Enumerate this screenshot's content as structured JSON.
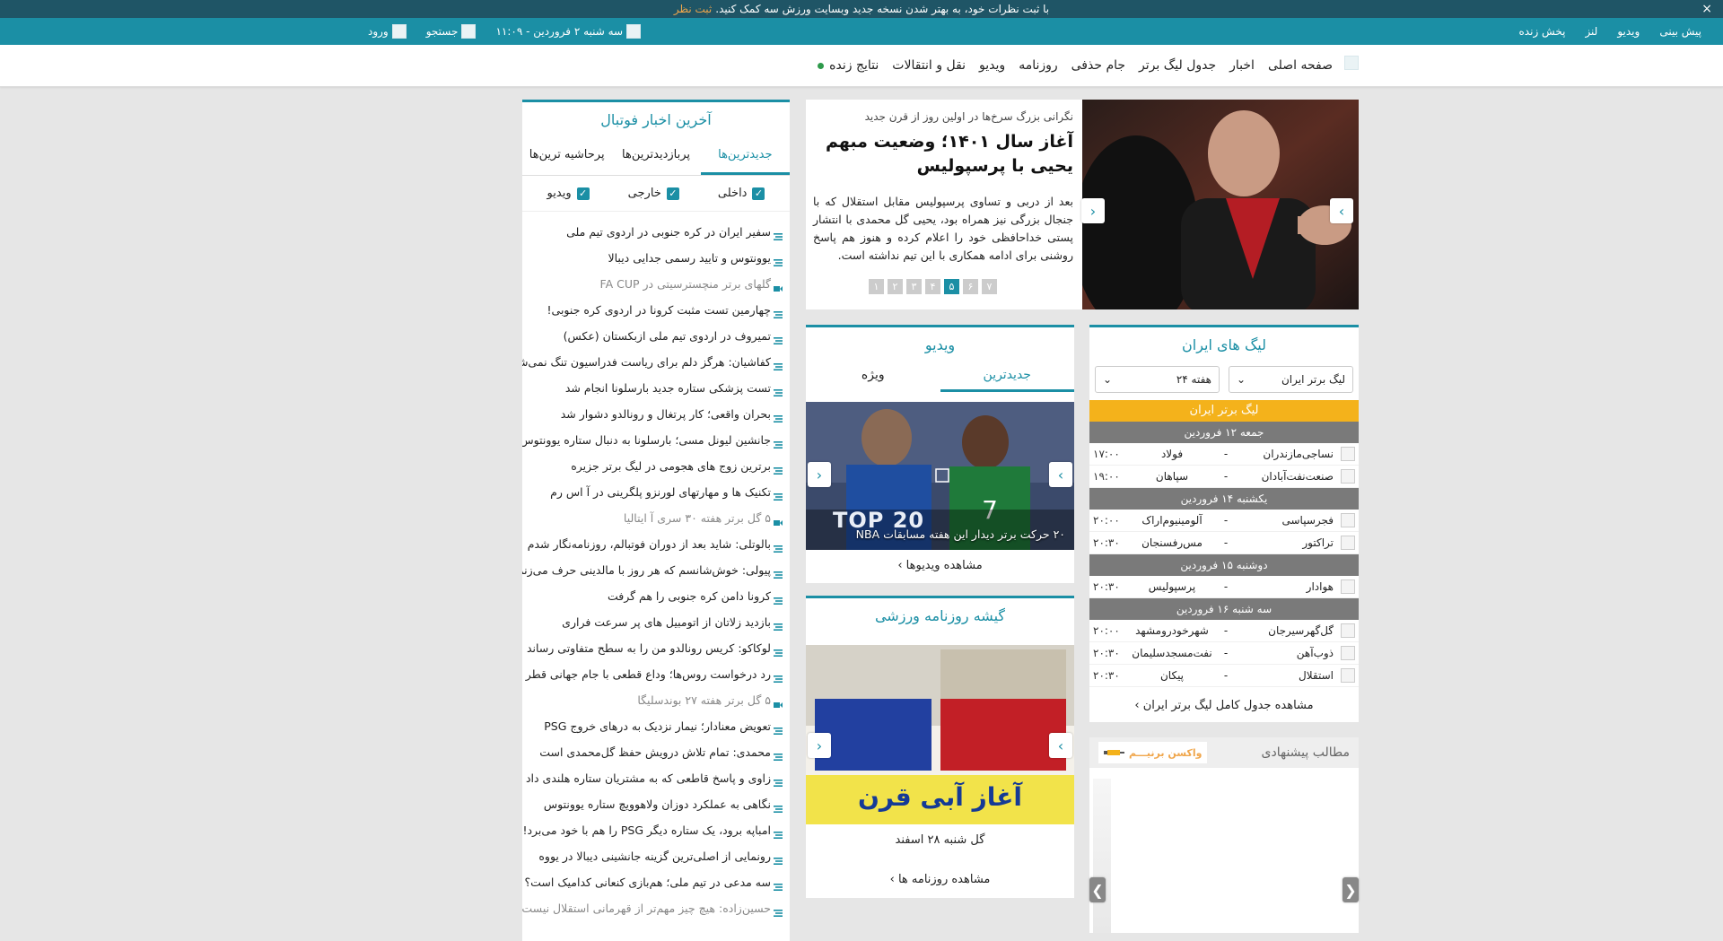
{
  "notice": {
    "text": "با ثبت نظرات خود، به بهتر شدن نسخه جدید وبسایت ورزش سه کمک کنید.",
    "link": "ثبت نظر",
    "close": "×"
  },
  "topbar": {
    "links": [
      "پیش بینی",
      "ویدیو",
      "لنز",
      "پخش زنده"
    ],
    "date": "سه شنبه ۲ فروردین - ۱۱:۰۹",
    "search": "جستجو",
    "login": "ورود"
  },
  "nav": {
    "items": [
      "صفحه اصلی",
      "اخبار",
      "جدول لیگ برتر",
      "جام حذفی",
      "روزنامه",
      "ویدیو",
      "نقل و انتقالات",
      "نتایج زنده"
    ]
  },
  "hero": {
    "kicker": "نگرانی بزرگ سرخ‌ها در اولین روز از قرن جدید",
    "headline": "آغاز سال ۱۴۰۱؛ وضعیت مبهم یحیی با پرسپولیس",
    "summary": "بعد از دربی و تساوی پرسپولیس مقابل استقلال که با جنجال بزرگی نیز همراه بود، یحیی گل محمدی با انتشار پستی خداحافظی خود را اعلام کرده و هنوز هم پاسخ روشنی برای ادامه همکاری با این تیم نداشته است.",
    "pages": [
      "۷",
      "۶",
      "۵",
      "۴",
      "۳",
      "۲",
      "۱"
    ],
    "active_page": 2
  },
  "latest": {
    "title": "آخرین اخبار فوتبال",
    "tabs": [
      "جدیدترین‌ها",
      "پربازدیدترین‌ها",
      "پرحاشیه ترین‌ها"
    ],
    "filters": [
      "داخلی",
      "خارجی",
      "ویدیو"
    ],
    "items": [
      "سفیر ایران در کره جنوبی در اردوی تیم ملی",
      "یوونتوس و تایید رسمی جدایی دیبالا",
      "گلهای برتر منچسترسیتی در FA CUP",
      "چهارمین تست مثبت کرونا در اردوی کره جنوبی!",
      "تمیروف در اردوی تیم ملی ازبکستان (عکس)",
      "کفاشیان: هرگز دلم برای ریاست فدراسیون تنگ نمی‌شود",
      "تست پزشکی ستاره جدید بارسلونا انجام شد",
      "بحران واقعی؛ کار پرتغال و رونالدو دشوار شد",
      "جانشین لیونل مسی؛ بارسلونا به دنبال ستاره یوونتوس",
      "برترین زوج های هجومی در لیگ برتر جزیره",
      "تکنیک ها و مهارتهای لورنزو پلگرینی در آ اس رم",
      "۵ گل برتر هفته ۳۰ سری آ ایتالیا",
      "بالوتلی: شاید بعد از دوران فوتبالم، روزنامه‌نگار شدم",
      "پیولی: خوش‌شانسم که هر روز با مالدینی حرف می‌زنم",
      "کرونا دامن کره جنوبی را هم گرفت",
      "بازدید زلاتان از اتومبیل های پر سرعت فراری",
      "لوکاکو: کریس رونالدو من را به سطح متفاوتی رساند",
      "رد درخواست روس‌ها؛ وداع قطعی با جام جهانی قطر",
      "۵ گل برتر هفته ۲۷ بوندسلیگا",
      "تعویض معنادار؛ نیمار نزدیک به درهای خروج PSG",
      "محمدی: تمام تلاش درویش حفظ گل‌محمدی است",
      "زاوی و پاسخ قاطعی که به مشتریان ستاره هلندی داد",
      "نگاهی به عملکرد دوزان ولاهوویچ ستاره یوونتوس",
      "امباپه برود، یک ستاره دیگر PSG را هم با خود می‌برد!",
      "رونمایی از اصلی‌ترین گزینه جانشینی دیبالا در یووه",
      "سه مدعی در تیم ملی؛ هم‌بازی کنعانی کدامیک است؟",
      "حسین‌زاده: هیچ چیز مهم‌تر از قهرمانی استقلال نیست"
    ],
    "video_indices": [
      2,
      11,
      18
    ]
  },
  "video": {
    "title": "ویدیو",
    "tabs": [
      "جدیدترین",
      "ویژه"
    ],
    "thumb_text": "TOP 20",
    "caption": "۲۰ حرکت برتر دیدار این هفته مسابقات NBA",
    "see_all": "مشاهده ویدیوها"
  },
  "paper": {
    "title": "گیشه روزنامه ورزشی",
    "headline": "آغاز آبی قرن",
    "label": "گل شنبه ۲۸ اسفند",
    "see_all": "مشاهده روزنامه ها"
  },
  "league": {
    "title": "لیگ های ایران",
    "select_league": "لیگ برتر ایران",
    "select_week": "هفته ۲۴",
    "league_name": "لیگ برتر ایران",
    "days": [
      {
        "label": "جمعه ۱۲ فروردین",
        "matches": [
          {
            "home": "نساجی‌مازندران",
            "away": "فولاد",
            "time": "۱۷:۰۰"
          },
          {
            "home": "صنعت‌نفت‌آبادان",
            "away": "سپاهان",
            "time": "۱۹:۰۰"
          }
        ]
      },
      {
        "label": "یکشنبه ۱۴ فروردین",
        "matches": [
          {
            "home": "فجرسپاسی",
            "away": "آلومینیوم‌اراک",
            "time": "۲۰:۰۰"
          },
          {
            "home": "تراکتور",
            "away": "مس‌رفسنجان",
            "time": "۲۰:۳۰"
          }
        ]
      },
      {
        "label": "دوشنبه ۱۵ فروردین",
        "matches": [
          {
            "home": "هوادار",
            "away": "پرسپولیس",
            "time": "۲۰:۳۰"
          }
        ]
      },
      {
        "label": "سه شنبه ۱۶ فروردین",
        "matches": [
          {
            "home": "گل‌گهرسیرجان",
            "away": "شهرخودرومشهد",
            "time": "۲۰:۰۰"
          },
          {
            "home": "ذوب‌آهن",
            "away": "نفت‌مسجدسلیمان",
            "time": "۲۰:۳۰"
          },
          {
            "home": "استقلال",
            "away": "پیکان",
            "time": "۲۰:۳۰"
          }
        ]
      }
    ],
    "see_all": "مشاهده جدول کامل لیگ برتر ایران",
    "dash": "-"
  },
  "suggest": {
    "title": "مطالب پیشنهادی",
    "brand": "واکسن برنیـــم"
  },
  "colors": {
    "teal": "#1b8fa5",
    "notice_bg": "#1f5566",
    "orange": "#f0a64b",
    "league_bar": "#f4b21b",
    "day_bar": "#7a7a7a"
  }
}
